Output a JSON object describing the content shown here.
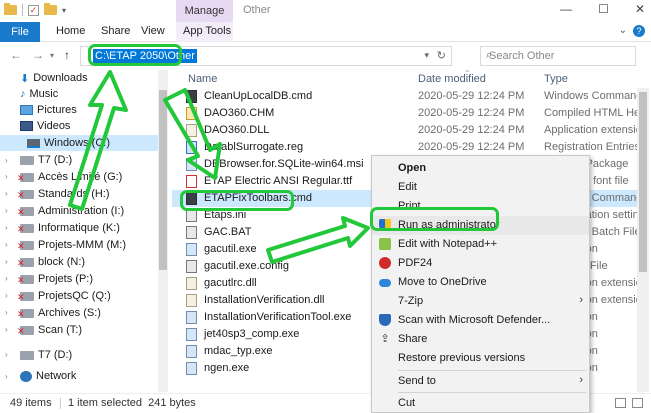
{
  "titlebar": {
    "manage_tab": "Manage",
    "title": "Other",
    "minimize": "—",
    "maximize": "☐",
    "close": "✕"
  },
  "ribbon": {
    "file": "File",
    "tabs": [
      "Home",
      "Share",
      "View",
      "App Tools"
    ]
  },
  "address": {
    "path": "C:\\ETAP 2050\\Other",
    "search_placeholder": "Search Other"
  },
  "sidebar": {
    "items": [
      {
        "label": "Downloads",
        "icon": "download-icon"
      },
      {
        "label": "Music",
        "icon": "music-icon"
      },
      {
        "label": "Pictures",
        "icon": "pictures-icon"
      },
      {
        "label": "Videos",
        "icon": "videos-icon"
      },
      {
        "label": "Windows (C:)",
        "icon": "windows-drive-icon"
      },
      {
        "label": "T7 (D:)",
        "icon": "drive-icon"
      },
      {
        "label": "Accès Limité (G:)",
        "icon": "network-drive-icon"
      },
      {
        "label": "Standards (H:)",
        "icon": "network-drive-icon"
      },
      {
        "label": "Administration (I:)",
        "icon": "network-drive-icon"
      },
      {
        "label": "Informatique (K:)",
        "icon": "network-drive-icon"
      },
      {
        "label": "Projets-MMM (M:)",
        "icon": "network-drive-icon"
      },
      {
        "label": "block (N:)",
        "icon": "network-drive-icon"
      },
      {
        "label": "Projets (P:)",
        "icon": "network-drive-icon"
      },
      {
        "label": "ProjetsQC (Q:)",
        "icon": "network-drive-icon"
      },
      {
        "label": "Archives (S:)",
        "icon": "network-drive-icon"
      },
      {
        "label": "Scan (T:)",
        "icon": "network-drive-icon"
      },
      {
        "label": "T7 (D:)",
        "icon": "drive-icon"
      },
      {
        "label": "Network",
        "icon": "network-icon"
      }
    ]
  },
  "columns": {
    "name": "Name",
    "date": "Date modified",
    "type": "Type"
  },
  "files": [
    {
      "name": "CleanUpLocalDB.cmd",
      "date": "2020-05-29 12:24 PM",
      "type": "Windows Command...",
      "kind": "cmd"
    },
    {
      "name": "DAO360.CHM",
      "date": "2020-05-29 12:24 PM",
      "type": "Compiled HTML Hel...",
      "kind": "chm"
    },
    {
      "name": "DAO360.DLL",
      "date": "2020-05-29 12:24 PM",
      "type": "Application extension",
      "kind": "dll"
    },
    {
      "name": "DatablSurrogate.reg",
      "date": "2020-05-29 12:24 PM",
      "type": "Registration Entries",
      "kind": "reg"
    },
    {
      "name": "DBBrowser.for.SQLite-win64.msi",
      "date": "",
      "type": "Installer Package",
      "kind": "exe"
    },
    {
      "name": "ETAP Electric ANSI Regular.ttf",
      "date": "",
      "type": "TrueType font file",
      "kind": "ttf"
    },
    {
      "name": "ETAPFixToolbars.cmd",
      "date": "",
      "type": "Windows Command...",
      "kind": "cmd"
    },
    {
      "name": "Etaps.ini",
      "date": "",
      "type": "Configuration setting",
      "kind": "bat"
    },
    {
      "name": "GAC.BAT",
      "date": "",
      "type": "Windows Batch File",
      "kind": "bat"
    },
    {
      "name": "gacutil.exe",
      "date": "",
      "type": "Application",
      "kind": "exe"
    },
    {
      "name": "gacutil.exe.config",
      "date": "",
      "type": "CONFIG File",
      "kind": "bat"
    },
    {
      "name": "gacutlrc.dll",
      "date": "",
      "type": "Application extension",
      "kind": "dll"
    },
    {
      "name": "InstallationVerification.dll",
      "date": "",
      "type": "Application extension",
      "kind": "dll"
    },
    {
      "name": "InstallationVerificationTool.exe",
      "date": "",
      "type": "Application",
      "kind": "exe"
    },
    {
      "name": "jet40sp3_comp.exe",
      "date": "",
      "type": "Application",
      "kind": "exe"
    },
    {
      "name": "mdac_typ.exe",
      "date": "",
      "type": "Application",
      "kind": "exe"
    },
    {
      "name": "ngen.exe",
      "date": "",
      "type": "Application",
      "kind": "exe"
    }
  ],
  "context_menu": {
    "items": [
      {
        "label": "Open",
        "bold": true,
        "icon": ""
      },
      {
        "label": "Edit",
        "icon": ""
      },
      {
        "label": "Print",
        "icon": ""
      },
      {
        "label": "Run as administrator",
        "icon": "shield-icon"
      },
      {
        "label": "Edit with Notepad++",
        "icon": "notepadpp-icon"
      },
      {
        "label": "PDF24",
        "icon": "pdf24-icon"
      },
      {
        "label": "Move to OneDrive",
        "icon": "onedrive-icon"
      },
      {
        "label": "7-Zip",
        "icon": "",
        "submenu": true
      },
      {
        "label": "Scan with Microsoft Defender...",
        "icon": "defender-icon"
      },
      {
        "label": "Share",
        "icon": "share-icon"
      },
      {
        "label": "Restore previous versions",
        "icon": ""
      },
      {
        "label": "Send to",
        "icon": "",
        "submenu": true
      },
      {
        "label": "Cut",
        "icon": ""
      }
    ]
  },
  "status": {
    "items": "49 items",
    "selected": "1 item selected  241 bytes"
  },
  "colors": {
    "accent": "#0078d7",
    "highlight_green": "#22c73a",
    "manage_tab": "#e8d9f3"
  }
}
